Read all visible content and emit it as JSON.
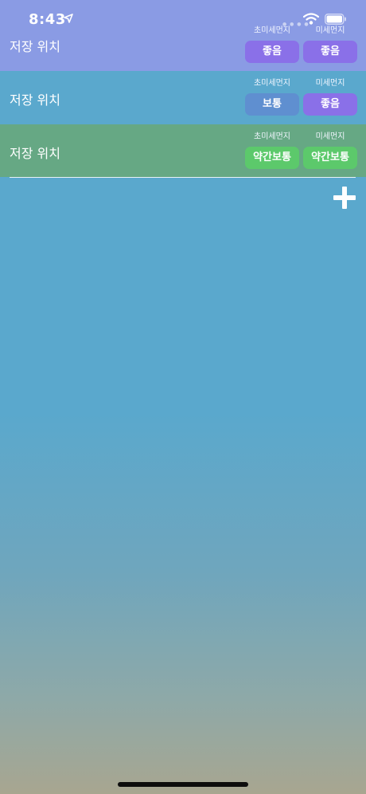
{
  "status_bar": {
    "time": "8:43",
    "icons": [
      "location-arrow-icon",
      "signal-icon",
      "wifi-icon",
      "battery-icon"
    ]
  },
  "locations": [
    {
      "title": "저장 위치",
      "row_color": "#8a9be4",
      "fine_dust_label": "초미세먼지",
      "fine_dust_value": "좋음",
      "fine_dust_color": "#8a70e8",
      "dust_label": "미세먼지",
      "dust_value": "좋음",
      "dust_color": "#8a70e8"
    },
    {
      "title": "저장 위치",
      "row_color": "#5aa8cd",
      "fine_dust_label": "초미세먼지",
      "fine_dust_value": "보통",
      "fine_dust_color": "#5f8fd0",
      "dust_label": "미세먼지",
      "dust_value": "좋음",
      "dust_color": "#8a70e8"
    },
    {
      "title": "저장 위치",
      "row_color": "#66a884",
      "fine_dust_label": "초미세먼지",
      "fine_dust_value": "약간보통",
      "fine_dust_color": "#5cc96b",
      "dust_label": "미세먼지",
      "dust_value": "약간보통",
      "dust_color": "#5cc96b"
    }
  ],
  "add_button": {
    "icon": "plus-icon"
  },
  "colors": {
    "background_top": "#5aa8cd",
    "background_bottom": "#a8a690"
  }
}
